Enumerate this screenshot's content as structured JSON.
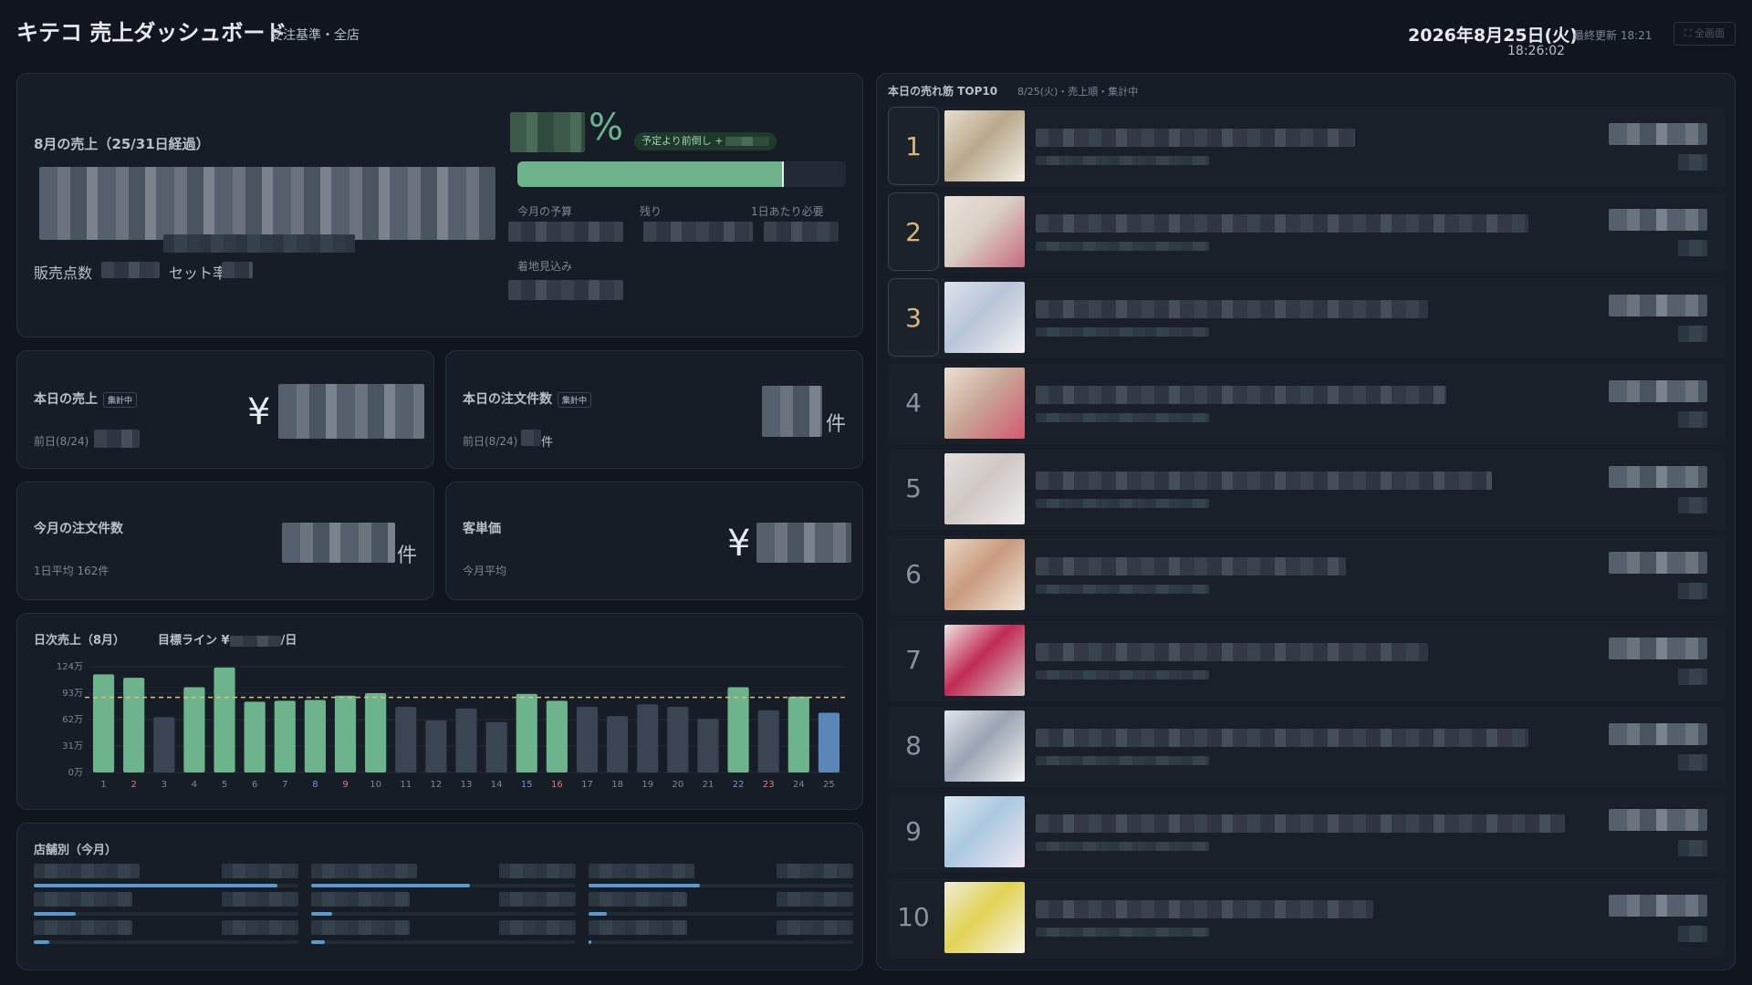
{
  "header": {
    "title": "キテコ 売上ダッシュボード",
    "subtitle": "受注基準・全店",
    "date": "2026年8月25日(火)",
    "time": "18:26:02",
    "last_update": "最終更新 18:21",
    "fullscreen_label": "⛶ 全画面"
  },
  "monthly": {
    "title": "8月の売上（25/31日経過）",
    "percent_sign": "%",
    "ahead_badge": "予定より前倒し +",
    "progress": 0.81,
    "budget_label": "今月の予算",
    "remaining_label": "残り",
    "per_day_label": "1日あたり必要",
    "landing_label": "着地見込み",
    "sales_count_label": "販売点数",
    "set_rate_label": "セット率"
  },
  "today_sales": {
    "title": "本日の売上",
    "badge": "集計中",
    "currency": "¥",
    "prev_label": "前日(8/24)"
  },
  "today_orders": {
    "title": "本日の注文件数",
    "badge": "集計中",
    "unit": "件",
    "prev_label": "前日(8/24)",
    "prev_unit": "件"
  },
  "month_orders": {
    "title": "今月の注文件数",
    "unit": "件",
    "avg": "1日平均 162件"
  },
  "avg_price": {
    "title": "客単価",
    "currency": "¥",
    "sub": "今月平均"
  },
  "daily_chart": {
    "title": "日次売上（8月）",
    "target_prefix": "目標ライン ¥",
    "target_suffix": "/日"
  },
  "chart_data": {
    "type": "bar",
    "categories": [
      "1",
      "2",
      "3",
      "4",
      "5",
      "6",
      "7",
      "8",
      "9",
      "10",
      "11",
      "12",
      "13",
      "14",
      "15",
      "16",
      "17",
      "18",
      "19",
      "20",
      "21",
      "22",
      "23",
      "24",
      "25"
    ],
    "values": [
      115,
      111,
      65,
      100,
      123,
      83,
      84,
      85,
      90,
      93,
      77,
      61,
      75,
      59,
      92,
      84,
      77,
      66,
      80,
      77,
      63,
      100,
      73,
      89,
      70
    ],
    "highlight": [
      true,
      true,
      false,
      true,
      true,
      true,
      true,
      true,
      true,
      true,
      false,
      false,
      false,
      false,
      true,
      true,
      false,
      false,
      false,
      false,
      false,
      true,
      false,
      true,
      false
    ],
    "today_index": 24,
    "target": 88,
    "yticks": [
      "0万",
      "31万",
      "62万",
      "93万",
      "124万"
    ],
    "ylim": [
      0,
      124
    ],
    "weekend_sat": [
      "8",
      "15",
      "22"
    ],
    "weekend_sun": [
      "2",
      "9",
      "16",
      "23"
    ],
    "colors": {
      "hit": "#6db38b",
      "miss": "#3a4452",
      "today": "#5b86b8",
      "target": "#d9c27a",
      "sat": "#6f93d6",
      "sun": "#d87b7b"
    }
  },
  "stores": {
    "title": "店舗別（今月）",
    "columns": [
      {
        "bars": [
          0.92,
          0.16,
          0.06
        ]
      },
      {
        "bars": [
          0.6,
          0.08,
          0.05
        ]
      },
      {
        "bars": [
          0.42,
          0.07,
          0.01
        ]
      }
    ]
  },
  "top10": {
    "title": "本日の売れ筋 TOP10",
    "sub": "8/25(火)・売上順・集計中",
    "ranks": [
      "1",
      "2",
      "3",
      "4",
      "5",
      "6",
      "7",
      "8",
      "9",
      "10"
    ]
  }
}
